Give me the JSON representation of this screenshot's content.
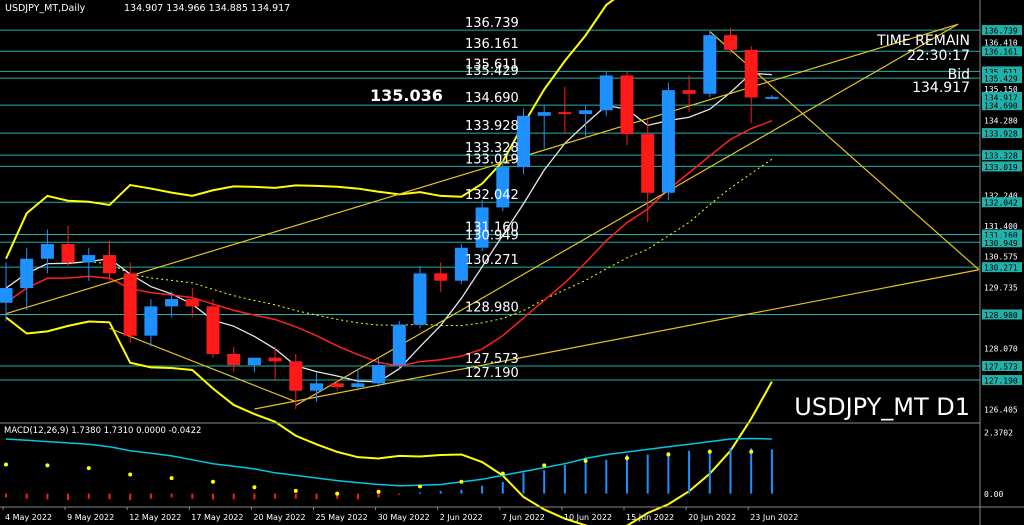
{
  "symbol_label": "USDJPY_MT,Daily",
  "ohlc_readout": "134.907 134.966 134.885 134.917",
  "watermark": "USDJPY_MT D1",
  "info": {
    "time_remain_label": "TIME REMAIN",
    "time_remain_value": "22:30:17",
    "bid_label": "Bid",
    "bid_value": "134.917"
  },
  "current_level_label": "135.036",
  "colors": {
    "background": "#000000",
    "bull": "#1e90ff",
    "bear": "#ff1a1a",
    "level_line": "#20b2aa",
    "bollinger": "#ffff00",
    "trendline": "#e6c31e",
    "ma_fast": "#e6e6e6",
    "ma_slow": "#ff2020",
    "macd_line": "#00c8e6",
    "macd_signal": "#ffff00"
  },
  "chart_data": {
    "type": "candlestick",
    "ylim": [
      126.1,
      137.15
    ],
    "x_labels": [
      "4 May 2022",
      "9 May 2022",
      "12 May 2022",
      "17 May 2022",
      "20 May 2022",
      "25 May 2022",
      "30 May 2022",
      "2 Jun 2022",
      "7 Jun 2022",
      "10 Jun 2022",
      "15 Jun 2022",
      "20 Jun 2022",
      "23 Jun 2022"
    ],
    "y_ticks": [
      "136.739",
      "136.410",
      "136.161",
      "135.611",
      "135.429",
      "135.150",
      "134.917",
      "134.690",
      "134.280",
      "133.928",
      "133.328",
      "133.019",
      "132.240",
      "132.042",
      "131.400",
      "131.160",
      "130.949",
      "130.575",
      "130.271",
      "129.735",
      "128.980",
      "128.070",
      "127.573",
      "127.190",
      "126.405"
    ],
    "highlighted_axis_levels": [
      "136.739",
      "136.161",
      "135.611",
      "135.429",
      "134.917",
      "134.690",
      "133.928",
      "133.328",
      "133.019",
      "132.042",
      "131.160",
      "130.949",
      "130.271",
      "128.980",
      "127.573",
      "127.190"
    ],
    "levels": [
      {
        "label": "136.739",
        "value": 136.739
      },
      {
        "label": "136.161",
        "value": 136.161
      },
      {
        "label": "135.611",
        "value": 135.611
      },
      {
        "label": "135.429",
        "value": 135.429
      },
      {
        "label": "134.690",
        "value": 134.69
      },
      {
        "label": "133.928",
        "value": 133.928
      },
      {
        "label": "133.328",
        "value": 133.328
      },
      {
        "label": "133.019",
        "value": 133.019
      },
      {
        "label": "132.042",
        "value": 132.042
      },
      {
        "label": "131.160",
        "value": 131.16
      },
      {
        "label": "130.949",
        "value": 130.949
      },
      {
        "label": "130.271",
        "value": 130.271
      },
      {
        "label": "128.980",
        "value": 128.98
      },
      {
        "label": "127.573",
        "value": 127.573
      },
      {
        "label": "127.190",
        "value": 127.19
      }
    ],
    "candles": [
      {
        "o": 129.3,
        "h": 130.4,
        "l": 128.8,
        "c": 129.7
      },
      {
        "o": 129.7,
        "h": 130.8,
        "l": 129.1,
        "c": 130.5
      },
      {
        "o": 130.5,
        "h": 131.3,
        "l": 130.1,
        "c": 130.9
      },
      {
        "o": 130.9,
        "h": 131.4,
        "l": 130.3,
        "c": 130.4
      },
      {
        "o": 130.4,
        "h": 130.8,
        "l": 129.9,
        "c": 130.6
      },
      {
        "o": 130.6,
        "h": 131.0,
        "l": 129.9,
        "c": 130.1
      },
      {
        "o": 130.1,
        "h": 130.4,
        "l": 128.2,
        "c": 128.4
      },
      {
        "o": 128.4,
        "h": 129.4,
        "l": 128.1,
        "c": 129.2
      },
      {
        "o": 129.2,
        "h": 129.6,
        "l": 128.9,
        "c": 129.4
      },
      {
        "o": 129.4,
        "h": 129.7,
        "l": 128.9,
        "c": 129.2
      },
      {
        "o": 129.2,
        "h": 129.4,
        "l": 127.8,
        "c": 127.9
      },
      {
        "o": 127.9,
        "h": 128.1,
        "l": 127.4,
        "c": 127.6
      },
      {
        "o": 127.6,
        "h": 127.8,
        "l": 127.4,
        "c": 127.8
      },
      {
        "o": 127.8,
        "h": 128.1,
        "l": 127.2,
        "c": 127.7
      },
      {
        "o": 127.7,
        "h": 127.9,
        "l": 126.4,
        "c": 126.9
      },
      {
        "o": 126.9,
        "h": 127.4,
        "l": 126.6,
        "c": 127.1
      },
      {
        "o": 127.1,
        "h": 127.2,
        "l": 126.9,
        "c": 127.0
      },
      {
        "o": 127.0,
        "h": 127.5,
        "l": 126.9,
        "c": 127.1
      },
      {
        "o": 127.1,
        "h": 127.8,
        "l": 127.0,
        "c": 127.6
      },
      {
        "o": 127.6,
        "h": 128.8,
        "l": 127.5,
        "c": 128.7
      },
      {
        "o": 128.7,
        "h": 130.3,
        "l": 128.6,
        "c": 130.1
      },
      {
        "o": 130.1,
        "h": 130.4,
        "l": 129.6,
        "c": 129.9
      },
      {
        "o": 129.9,
        "h": 130.9,
        "l": 129.8,
        "c": 130.8
      },
      {
        "o": 130.8,
        "h": 132.1,
        "l": 130.7,
        "c": 131.9
      },
      {
        "o": 131.9,
        "h": 133.2,
        "l": 131.8,
        "c": 133.0
      },
      {
        "o": 133.0,
        "h": 134.6,
        "l": 132.8,
        "c": 134.4
      },
      {
        "o": 134.4,
        "h": 134.7,
        "l": 133.5,
        "c": 134.5
      },
      {
        "o": 134.5,
        "h": 135.2,
        "l": 133.9,
        "c": 134.45
      },
      {
        "o": 134.45,
        "h": 134.7,
        "l": 133.8,
        "c": 134.55
      },
      {
        "o": 134.55,
        "h": 135.6,
        "l": 134.4,
        "c": 135.5
      },
      {
        "o": 135.5,
        "h": 135.6,
        "l": 133.6,
        "c": 133.9
      },
      {
        "o": 133.9,
        "h": 134.3,
        "l": 131.5,
        "c": 132.3
      },
      {
        "o": 132.3,
        "h": 135.3,
        "l": 132.1,
        "c": 135.1
      },
      {
        "o": 135.1,
        "h": 135.5,
        "l": 134.5,
        "c": 135.0
      },
      {
        "o": 135.0,
        "h": 136.7,
        "l": 134.9,
        "c": 136.6
      },
      {
        "o": 136.6,
        "h": 136.8,
        "l": 136.1,
        "c": 136.2
      },
      {
        "o": 136.2,
        "h": 136.3,
        "l": 134.2,
        "c": 134.9
      },
      {
        "o": 134.9,
        "h": 134.97,
        "l": 134.88,
        "c": 134.917
      }
    ],
    "indicator": {
      "label": "MACD(12,26,9) 1.7380 1.7310 0.0000 -0.0422",
      "y_ticks": [
        "2.3702",
        "0.00"
      ],
      "ylim": [
        -0.4,
        2.6
      ],
      "histogram": [
        -0.15,
        -0.2,
        -0.22,
        -0.25,
        -0.2,
        -0.22,
        -0.25,
        -0.2,
        -0.15,
        -0.2,
        -0.22,
        -0.22,
        -0.22,
        -0.2,
        -0.2,
        -0.22,
        -0.2,
        -0.22,
        -0.15,
        -0.05,
        0.05,
        0.1,
        0.15,
        0.3,
        0.45,
        0.8,
        0.9,
        1.1,
        1.4,
        1.3,
        1.5,
        1.5,
        1.6,
        1.65,
        1.7,
        1.75,
        1.74,
        1.7
      ],
      "macd": [
        1.6,
        1.7,
        1.55,
        1.45,
        1.4,
        1.2,
        1.05,
        0.95,
        0.85,
        0.75,
        0.65,
        0.45,
        0.35,
        0.2,
        0.15,
        0.05,
        0.0,
        0.0,
        0.1,
        0.25,
        0.4,
        0.5,
        0.65,
        0.9,
        1.1,
        1.35,
        1.55,
        1.7,
        1.8,
        1.9,
        1.95,
        2.05,
        2.15,
        2.25,
        2.3,
        2.35,
        2.3,
        2.25
      ],
      "signal": [
        2.1,
        2.05,
        2.0,
        1.95,
        1.9,
        1.8,
        1.65,
        1.55,
        1.45,
        1.3,
        1.15,
        1.05,
        0.95,
        0.8,
        0.7,
        0.6,
        0.5,
        0.42,
        0.35,
        0.3,
        0.32,
        0.35,
        0.45,
        0.55,
        0.7,
        0.85,
        1.0,
        1.15,
        1.35,
        1.5,
        1.6,
        1.7,
        1.8,
        1.9,
        2.0,
        2.1,
        2.12,
        2.1
      ]
    }
  }
}
